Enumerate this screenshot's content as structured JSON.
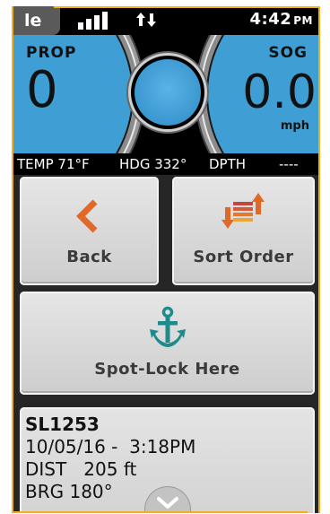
{
  "status_bar": {
    "carrier": "le",
    "time": "4:42",
    "ampm": "PM"
  },
  "gauges": {
    "prop_label": "PROP",
    "prop_value": "0",
    "sog_label": "SOG",
    "sog_value": "0.0",
    "sog_unit": "mph"
  },
  "info_strip": {
    "temp": "TEMP 71°F",
    "heading": "HDG 332°",
    "depth_label": "DPTH",
    "depth_value": "----"
  },
  "buttons": {
    "back_label": "Back",
    "sort_label": "Sort Order",
    "spot_lock_label": "Spot-Lock Here"
  },
  "waypoint": {
    "name": "SL1253",
    "datetime": "10/05/16 -  3:18PM",
    "distance": "DIST   205 ft",
    "bearing": "BRG 180°"
  },
  "colors": {
    "accent_orange": "#e0692a",
    "accent_teal": "#1f8a8a",
    "gauge_blue": "#3f9fd4",
    "frame_yellow": "#f2b01e"
  },
  "icons": [
    "signal-icon",
    "data-arrows-icon",
    "back-arrow-icon",
    "sort-order-icon",
    "anchor-icon",
    "chevron-down-icon"
  ]
}
